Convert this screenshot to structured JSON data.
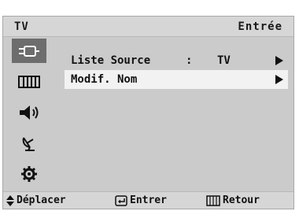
{
  "header": {
    "left_title": "TV",
    "right_title": "Entrée"
  },
  "sidebar": {
    "items": [
      {
        "icon": "input-icon",
        "active": true
      },
      {
        "icon": "picture-icon",
        "active": false
      },
      {
        "icon": "sound-icon",
        "active": false
      },
      {
        "icon": "channel-icon",
        "active": false
      },
      {
        "icon": "setup-icon",
        "active": false
      }
    ]
  },
  "menu": {
    "items": [
      {
        "label": "Liste Source",
        "separator": ":",
        "value": "TV",
        "selected": false
      },
      {
        "label": "Modif. Nom",
        "separator": "",
        "value": "",
        "selected": true
      }
    ]
  },
  "footer": {
    "move_label": "Déplacer",
    "enter_label": "Entrer",
    "return_label": "Retour"
  }
}
